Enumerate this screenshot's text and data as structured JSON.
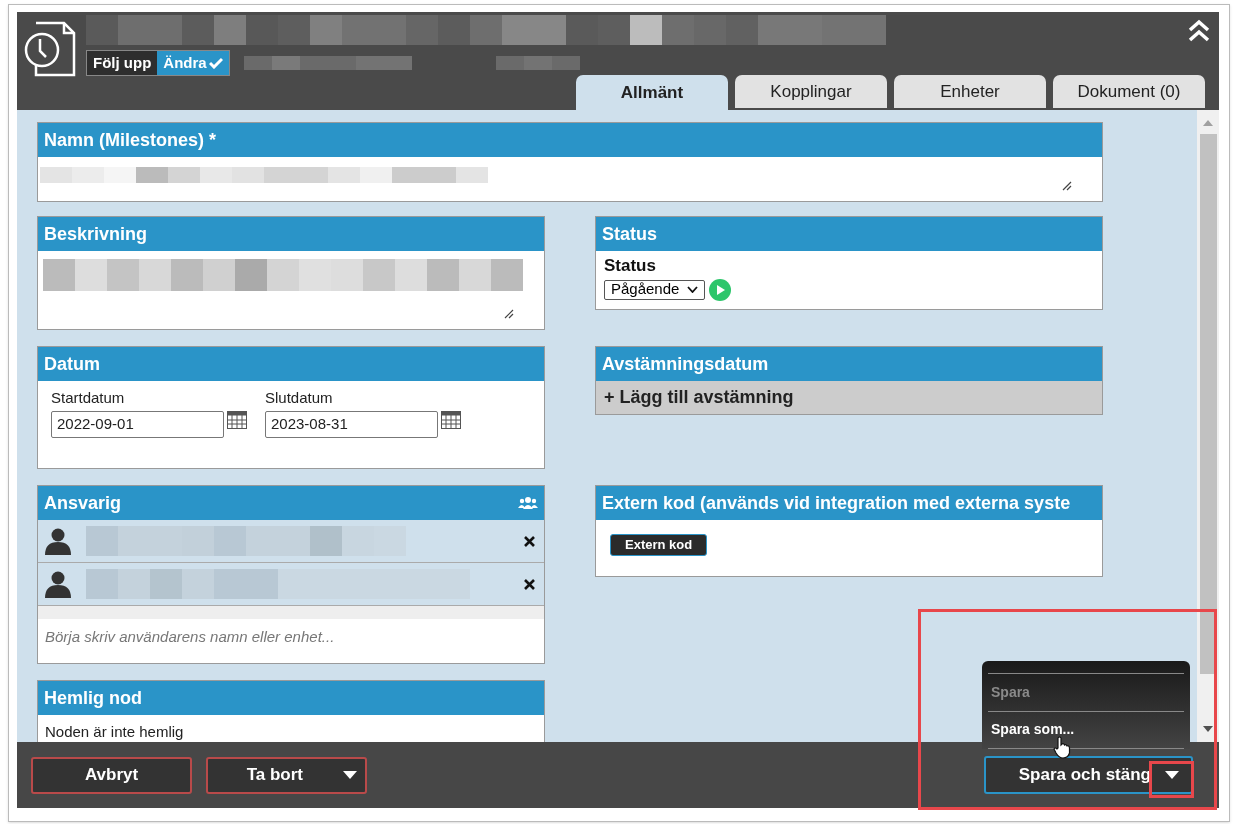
{
  "header": {
    "modes": [
      {
        "label": "Följ upp",
        "selected": false
      },
      {
        "label": "Ändra",
        "selected": true
      }
    ]
  },
  "tabs": [
    {
      "label": "Allmänt",
      "selected": true
    },
    {
      "label": "Kopplingar",
      "selected": false
    },
    {
      "label": "Enheter",
      "selected": false
    },
    {
      "label": "Dokument (0)",
      "selected": false
    }
  ],
  "name_section": {
    "title": "Namn (Milestones) *"
  },
  "description_section": {
    "title": "Beskrivning"
  },
  "status_section": {
    "title": "Status",
    "field_label": "Status",
    "value": "Pågående"
  },
  "date_section": {
    "title": "Datum",
    "fields": [
      {
        "label": "Startdatum",
        "value": "2022-09-01"
      },
      {
        "label": "Slutdatum",
        "value": "2023-08-31"
      }
    ]
  },
  "reconciliation_section": {
    "title": "Avstämningsdatum",
    "add_label": "+ Lägg till avstämning"
  },
  "responsible_section": {
    "title": "Ansvarig",
    "people": [
      {
        "kind": "redacted"
      },
      {
        "kind": "redacted"
      }
    ],
    "placeholder": "Börja skriv användarens namn eller enhet..."
  },
  "external_section": {
    "title": "Extern kod (används vid integration med externa syste",
    "button": "Extern kod"
  },
  "secret_section": {
    "title": "Hemlig nod",
    "text": "Noden är inte hemlig"
  },
  "footer": {
    "cancel": "Avbryt",
    "delete": "Ta bort",
    "save": "Spara och stäng"
  },
  "save_menu": [
    {
      "label": "Spara",
      "disabled": true
    },
    {
      "label": "Spara som...",
      "disabled": false
    }
  ]
}
